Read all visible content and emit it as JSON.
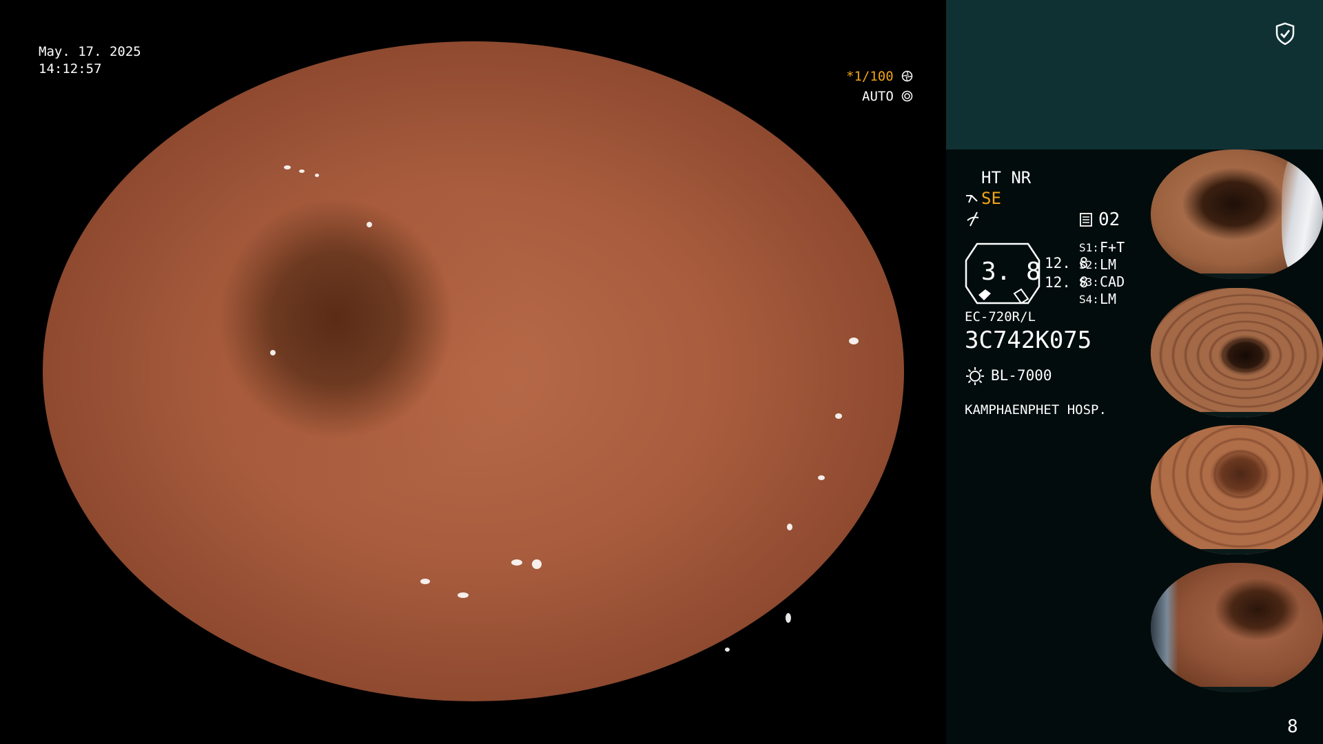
{
  "overlay": {
    "date": "May. 17. 2025",
    "time": "14:12:57",
    "shutter": "*1/100",
    "auto": "AUTO"
  },
  "panel": {
    "ht_nr": "HT  NR",
    "se": "SE",
    "count": "02",
    "gauge_value": "3. 8",
    "val1": "12. 8",
    "val2": "12. 8",
    "s1": "F+T",
    "s2": "LM",
    "s3": "CAD",
    "s4": "LM",
    "s1_label": "S1:",
    "s2_label": "S2:",
    "s3_label": "S3:",
    "s4_label": "S4:",
    "scope_model": "EC-720R/L",
    "serial": "3C742K075",
    "light_source": "BL-7000",
    "hospital": "KAMPHAENPHET  HOSP.",
    "page_number": "8"
  },
  "colors": {
    "accent_orange": "#f2a516",
    "panel_top": "#0f3133",
    "panel_bg": "#020c0c"
  },
  "icons": [
    "shield-check-icon",
    "scope-icon",
    "lightning-icon",
    "memo-icon",
    "lamp-icon",
    "aperture-icon",
    "iris-icon"
  ]
}
